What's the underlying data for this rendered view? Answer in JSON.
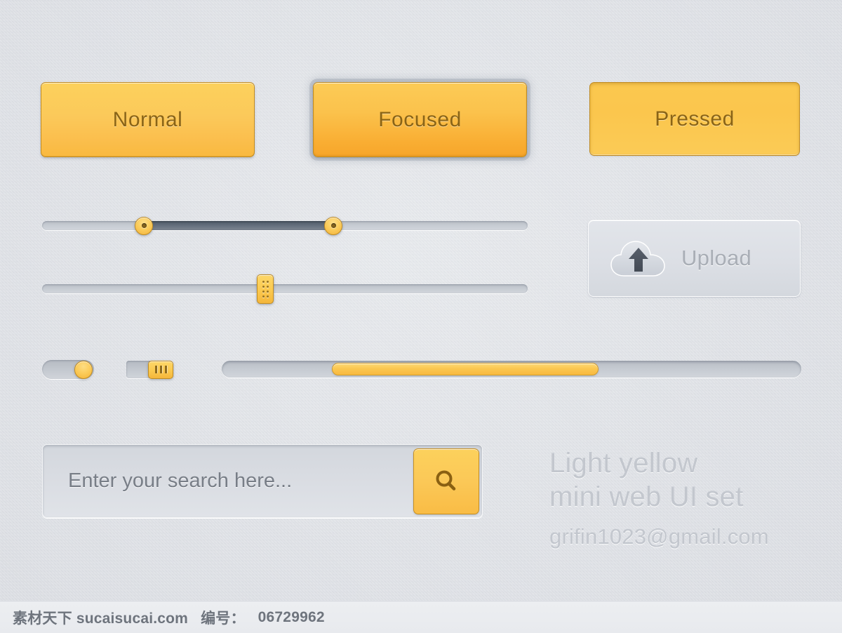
{
  "buttons": {
    "normal": {
      "label": "Normal",
      "state": "normal"
    },
    "focused": {
      "label": "Focused",
      "state": "focused"
    },
    "pressed": {
      "label": "Pressed",
      "state": "pressed"
    }
  },
  "range_slider": {
    "name": "dual-handle range slider",
    "left_handle_percent": 21,
    "right_handle_percent": 60,
    "fill_color": "#5a6370",
    "track_color": "#c7ccd3"
  },
  "single_slider": {
    "name": "single handle slider",
    "handle_percent": 46,
    "track_color": "#c7ccd3"
  },
  "toggle_round": {
    "name": "round toggle switch",
    "on": true,
    "knob_color": "#fbcb58"
  },
  "toggle_square": {
    "name": "square toggle switch",
    "on": true,
    "knob_color": "#fbc94f",
    "grip_lines": 3
  },
  "progress": {
    "name": "progress bar",
    "start_percent": 19,
    "end_percent": 65,
    "bar_color": "#fbc750"
  },
  "upload": {
    "label": "Upload",
    "icon": "cloud-upload-icon"
  },
  "search": {
    "placeholder": "Enter your search here...",
    "value": "",
    "button_icon": "search-icon"
  },
  "credit": {
    "line1": "Light yellow",
    "line2": "mini web UI set",
    "email": "grifin1023@gmail.com"
  },
  "watermark": {
    "site": "素材天下 sucaisucai.com",
    "id_label": "编号：",
    "id_value": "06729962"
  },
  "colors": {
    "yellow": "#fbc950",
    "yellow_dark": "#f9b93f",
    "yellow_border": "#c28c22",
    "background": "#dfe2e7",
    "text_gray": "#c3c7ce",
    "slider_dark": "#5a6370"
  }
}
